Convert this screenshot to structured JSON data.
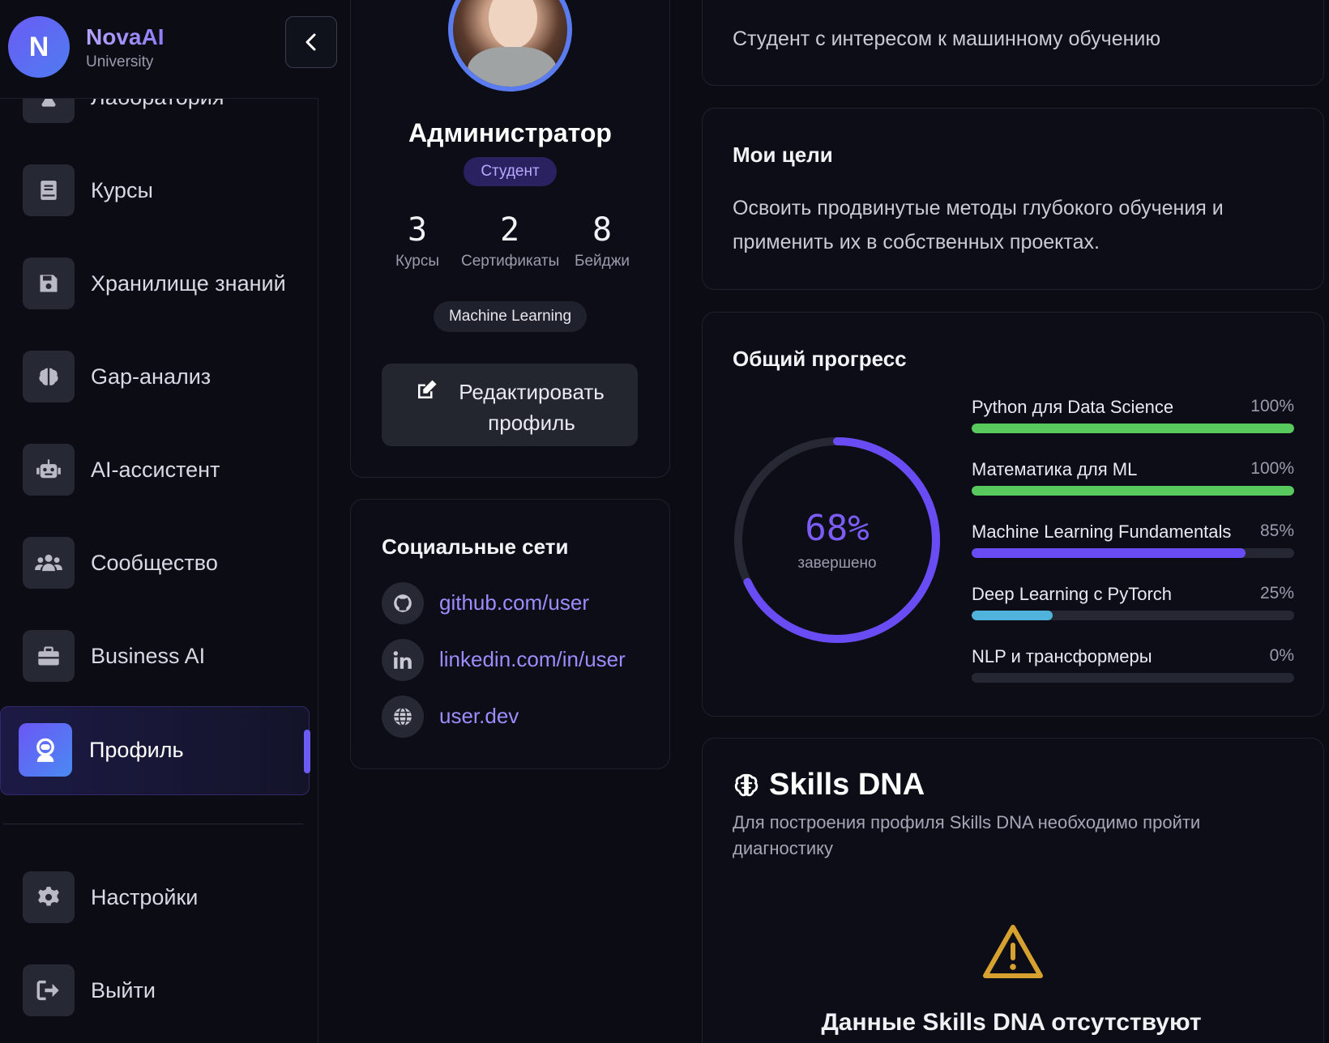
{
  "brand": {
    "initial": "N",
    "name": "NovaAI",
    "subtitle": "University"
  },
  "sidebar": {
    "items": [
      {
        "label": "Лаборатория",
        "icon": "flask-icon"
      },
      {
        "label": "Курсы",
        "icon": "book-icon"
      },
      {
        "label": "Хранилище знаний",
        "icon": "save-icon"
      },
      {
        "label": "Gap-анализ",
        "icon": "brain-icon"
      },
      {
        "label": "AI-ассистент",
        "icon": "robot-icon"
      },
      {
        "label": "Сообщество",
        "icon": "users-icon"
      },
      {
        "label": "Business AI",
        "icon": "briefcase-icon"
      },
      {
        "label": "Профиль",
        "icon": "astronaut-icon",
        "active": true
      }
    ],
    "footer": [
      {
        "label": "Настройки",
        "icon": "gear-icon"
      },
      {
        "label": "Выйти",
        "icon": "logout-icon"
      }
    ]
  },
  "profile": {
    "name": "Администратор",
    "role": "Студент",
    "stats": [
      {
        "value": "3",
        "label": "Курсы"
      },
      {
        "value": "2",
        "label": "Сертификаты"
      },
      {
        "value": "8",
        "label": "Бейджи"
      }
    ],
    "tag": "Machine Learning",
    "edit_button": "Редактировать профиль"
  },
  "social": {
    "title": "Социальные сети",
    "links": [
      {
        "icon": "github-icon",
        "text": "github.com/user"
      },
      {
        "icon": "linkedin-icon",
        "text": "linkedin.com/in/user"
      },
      {
        "icon": "globe-icon",
        "text": "user.dev"
      }
    ]
  },
  "about": {
    "text": "Студент с интересом к машинному обучению"
  },
  "goals": {
    "title": "Мои цели",
    "text": "Освоить продвинутые методы глубокого обучения и применить их в собственных проектах."
  },
  "progress": {
    "title": "Общий прогресс",
    "overall_percent": 68,
    "overall_label": "68%",
    "overall_sub": "завершено",
    "accent": "#6a4cf5",
    "courses": [
      {
        "name": "Python для Data Science",
        "value_label": "100%",
        "percent": 100,
        "color": "#57c95d"
      },
      {
        "name": "Математика для ML",
        "value_label": "100%",
        "percent": 100,
        "color": "#57c95d"
      },
      {
        "name": "Machine Learning Fundamentals",
        "value_label": "85%",
        "percent": 85,
        "color": "#6a4cf5"
      },
      {
        "name": "Deep Learning с PyTorch",
        "value_label": "25%",
        "percent": 25,
        "color": "#4fb3dc"
      },
      {
        "name": "NLP и трансформеры",
        "value_label": "0%",
        "percent": 0,
        "color": "#6a4cf5"
      }
    ]
  },
  "skills_dna": {
    "title": "Skills DNA",
    "subtitle": "Для построения профиля Skills DNA необходимо пройти диагностику",
    "empty_title": "Данные Skills DNA отсутствуют",
    "warning_color": "#d6a12e"
  }
}
